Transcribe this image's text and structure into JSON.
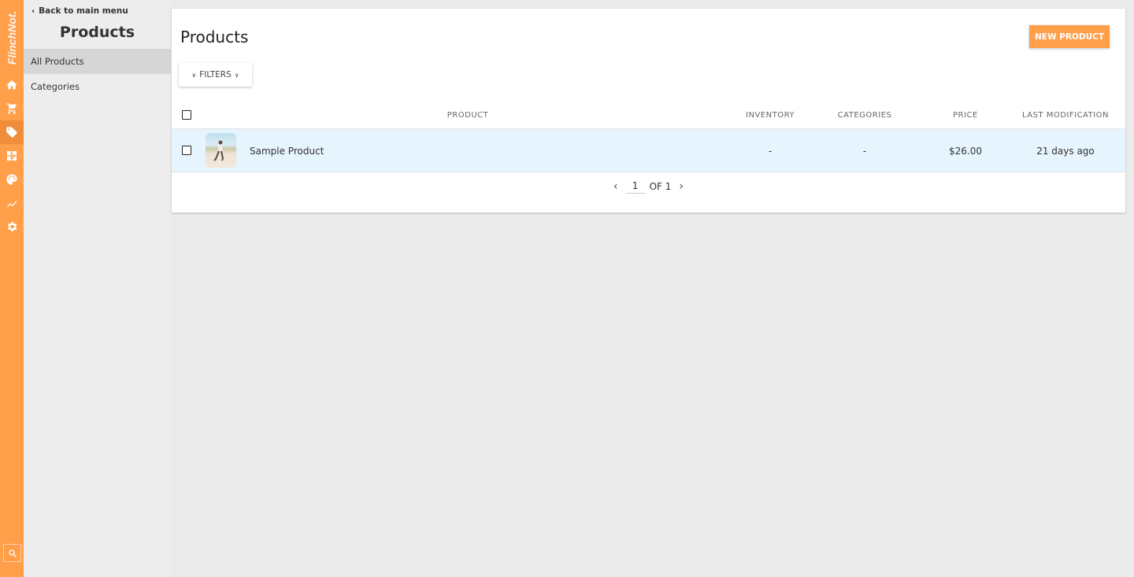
{
  "app": {
    "logo_text": "FlinchNot.",
    "accent_color": "#ff9f4a"
  },
  "rail": {
    "icons": [
      {
        "name": "home-icon",
        "label": "Home"
      },
      {
        "name": "cart-icon",
        "label": "Orders"
      },
      {
        "name": "tag-icon",
        "label": "Products",
        "active": true
      },
      {
        "name": "puzzle-icon",
        "label": "Extensions"
      },
      {
        "name": "palette-icon",
        "label": "Design"
      },
      {
        "name": "chart-line-icon",
        "label": "Analytics"
      },
      {
        "name": "gear-icon",
        "label": "Settings"
      }
    ],
    "search_icon": "search-icon"
  },
  "subnav": {
    "back_label": "Back to main menu",
    "title": "Products",
    "items": [
      {
        "label": "All Products",
        "active": true
      },
      {
        "label": "Categories",
        "active": false
      }
    ]
  },
  "main": {
    "title": "Products",
    "new_button_label": "NEW PRODUCT",
    "filters_label": "FILTERS",
    "table": {
      "columns": [
        "PRODUCT",
        "INVENTORY",
        "CATEGORIES",
        "PRICE",
        "LAST MODIFICATION"
      ],
      "rows": [
        {
          "product": "Sample Product",
          "inventory": "-",
          "categories": "-",
          "price": "$26.00",
          "last_modification": "21 days ago"
        }
      ]
    },
    "pagination": {
      "current_page": "1",
      "of_label": "OF 1"
    }
  }
}
